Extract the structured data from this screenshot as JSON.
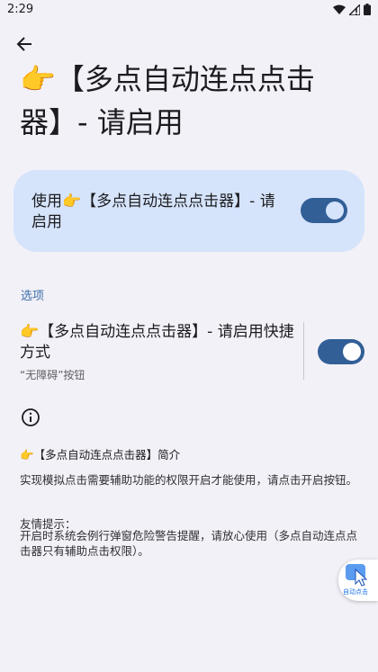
{
  "status_bar": {
    "time": "2:29"
  },
  "page": {
    "title": "👉【多点自动连点点击器】- 请启用"
  },
  "main_toggle": {
    "label": "使用👉【多点自动连点点击器】- 请启用",
    "checked": true
  },
  "options": {
    "header": "选项",
    "shortcut_title": "👉【多点自动连点点击器】- 请启用快捷方式",
    "shortcut_subtitle": "“无障碍”按钮",
    "shortcut_checked": true
  },
  "intro": {
    "title": "👉【多点自动连点点击器】简介",
    "body": " 实现模拟点击需要辅助功能的权限开启才能使用，请点击开启按钮。",
    "tip_label": "友情提示：",
    "tip_body": " 开启时系统会例行弹窗危险警告提醒，请放心使用（多点自动连点点击器只有辅助点击权限）。"
  },
  "floating_ball": {
    "label": "自动点击"
  },
  "colors": {
    "background": "#f2f1f7",
    "card": "#d5e4fb",
    "toggle_on": "#315f96",
    "accent": "#3b6ea8"
  }
}
